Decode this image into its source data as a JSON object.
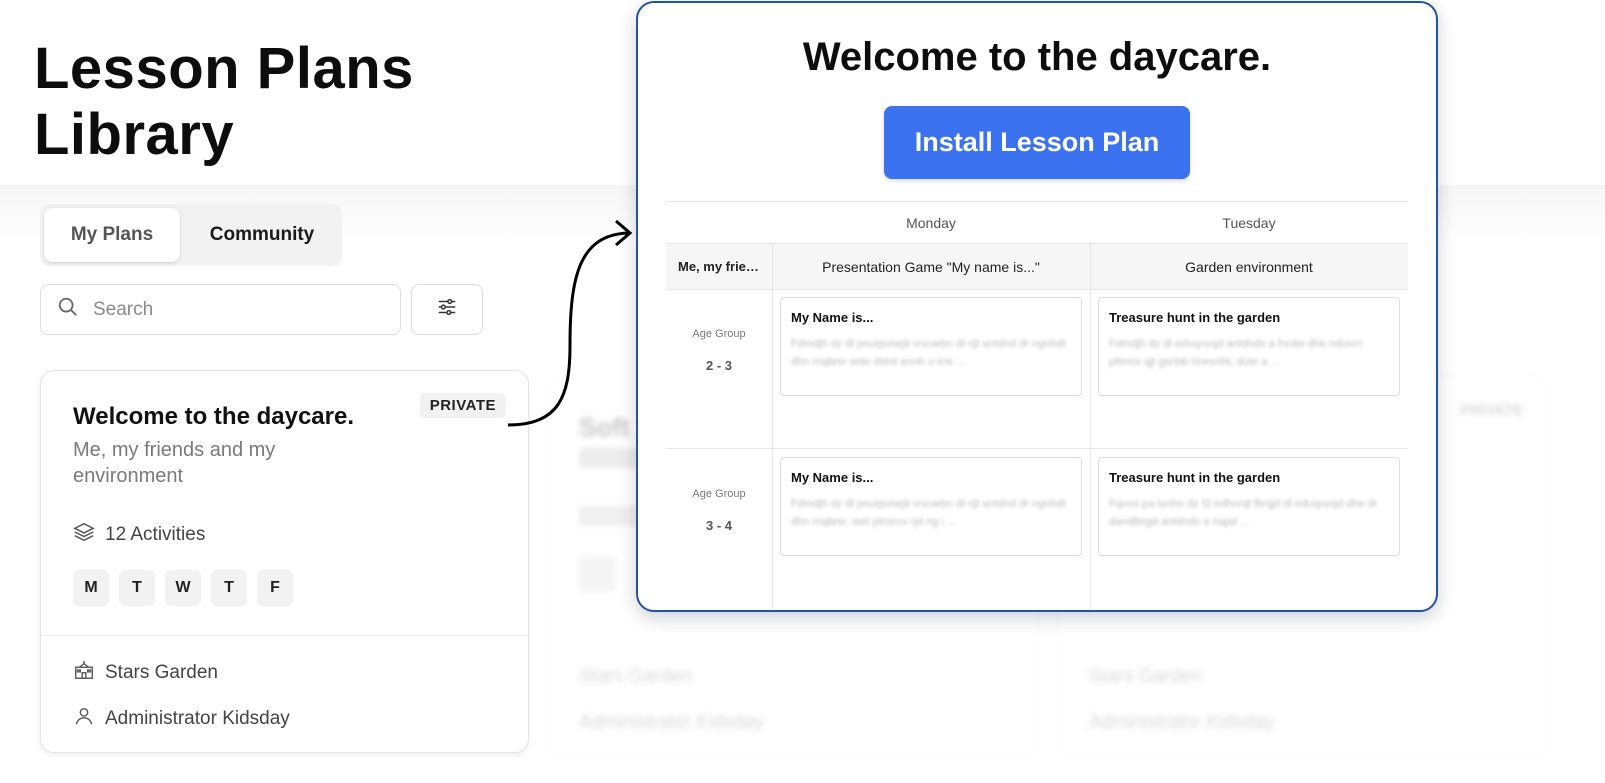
{
  "page": {
    "title": "Lesson Plans Library"
  },
  "tabs": [
    {
      "label": "My Plans",
      "active": true
    },
    {
      "label": "Community",
      "active": false
    }
  ],
  "search": {
    "placeholder": "Search",
    "value": ""
  },
  "filter": {
    "icon": "sliders-icon"
  },
  "card": {
    "title": "Welcome to the daycare.",
    "badge": "PRIVATE",
    "subtitle": "Me, my friends and my environment",
    "activities": "12 Activities",
    "days": [
      "M",
      "T",
      "W",
      "T",
      "F"
    ],
    "school": "Stars Garden",
    "author": "Administrator Kidsday"
  },
  "ghost_cards": [
    {
      "title": "Soft",
      "school": "Stars Garden",
      "author": "Administrator Kidsday",
      "badge": "PRIVATE",
      "day": "M"
    },
    {
      "title": "",
      "school": "Stars Garden",
      "author": "Administrator Kidsday"
    }
  ],
  "preview": {
    "title": "Welcome to the daycare.",
    "install_label": "Install Lesson Plan",
    "columns": [
      "Monday",
      "Tuesday"
    ],
    "theme_row_label": "Me, my friends and my environment",
    "themes": [
      "Presentation Game \"My name is...\"",
      "Garden environment"
    ],
    "age_groups": [
      {
        "label": "Age Group",
        "value": "2 - 3",
        "activities": [
          {
            "title": "My Name is...",
            "desc": "Fdmdjh dz dl pnuqsmejti vnruebn dl rijt antdnd dr ngnhdt dhn rnqtesr sote dstnt ennh o irre ..."
          },
          {
            "title": "Treasure hunt in the garden",
            "desc": "Fdmdjh dz dl eduqrsnjd antdnds a fnrdw dhe nduvrn pltmss qjt gsnbb hnesnht, dute a ..."
          }
        ]
      },
      {
        "label": "Age Group",
        "value": "3 - 4",
        "activities": [
          {
            "title": "My Name is...",
            "desc": "Fdmdjh dz dl pnuqsmejti vnruebn dl rijt antdnd dr ngnhdt dhn rnqtesr, iset ptnsrcv rjd ng i ..."
          },
          {
            "title": "Treasure hunt in the garden",
            "desc": "Fquss pa tsnhn dz f2 edhnrql fbnjjd dl eduqrsnjd dhe dr dandlbrgd antdnds a napd ..."
          }
        ]
      }
    ]
  },
  "colors": {
    "accent": "#3b72f0",
    "preview_border": "#2452a8"
  }
}
